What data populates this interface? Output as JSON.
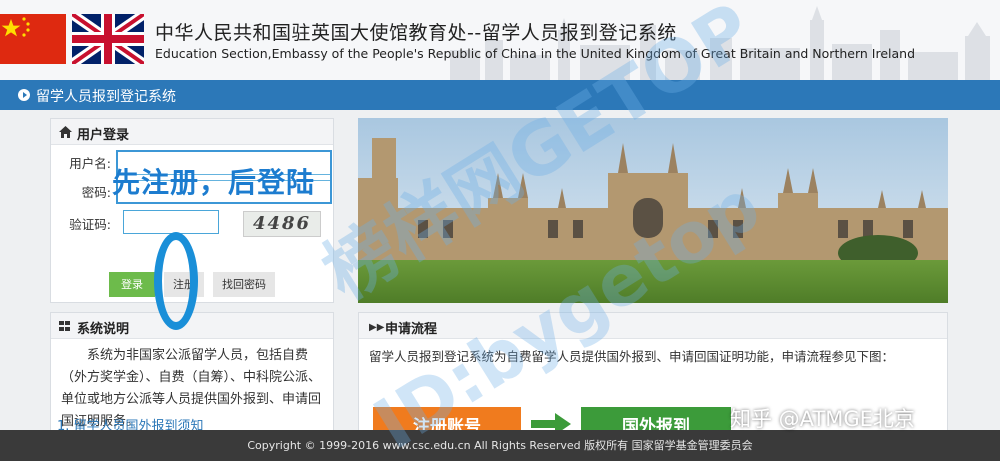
{
  "header": {
    "title": "中华人民共和国驻英国大使馆教育处--留学人员报到登记系统",
    "subtitle": "Education Section,Embassy of the People's Republic of China in the United Kingdom of Great Britain and Northern Ireland"
  },
  "nav": {
    "label": "留学人员报到登记系统"
  },
  "login": {
    "title": "用户登录",
    "username_label": "用户名:",
    "password_label": "密码:",
    "captcha_label": "验证码:",
    "captcha_value": "4486",
    "login_button": "登录",
    "register_button": "注册",
    "forgot_button": "找回密码"
  },
  "info": {
    "title": "系统说明",
    "body": "系统为非国家公派留学人员，包括自费（外方奖学金）、自费（自筹）、中科院公派、单位或地方公派等人员提供国外报到、申请回国证明服务。",
    "link": "1. 留学人员国外报到须知"
  },
  "process": {
    "title": "申请流程",
    "body": "留学人员报到登记系统为自费留学人员提供国外报到、申请回国证明功能，申请流程参见下图：",
    "step1": "注册账号",
    "step2": "国外报到"
  },
  "footer": {
    "text": "Copyright © 1999-2016 www.csc.edu.cn All Rights Reserved  版权所有  国家留学基金管理委员会"
  },
  "overlay": {
    "annotation": "先注册，后登陆",
    "watermark_cn": "榜样网GETOP",
    "watermark_en": "ID:bygetop",
    "zhihu": "知乎 @ATMGE北京"
  },
  "colors": {
    "nav_bar": "#2c78b8",
    "login_green": "#6dbb4b",
    "step_orange": "#f07b1e",
    "step_green": "#3c9b3a",
    "footer": "#3a3a3a"
  }
}
